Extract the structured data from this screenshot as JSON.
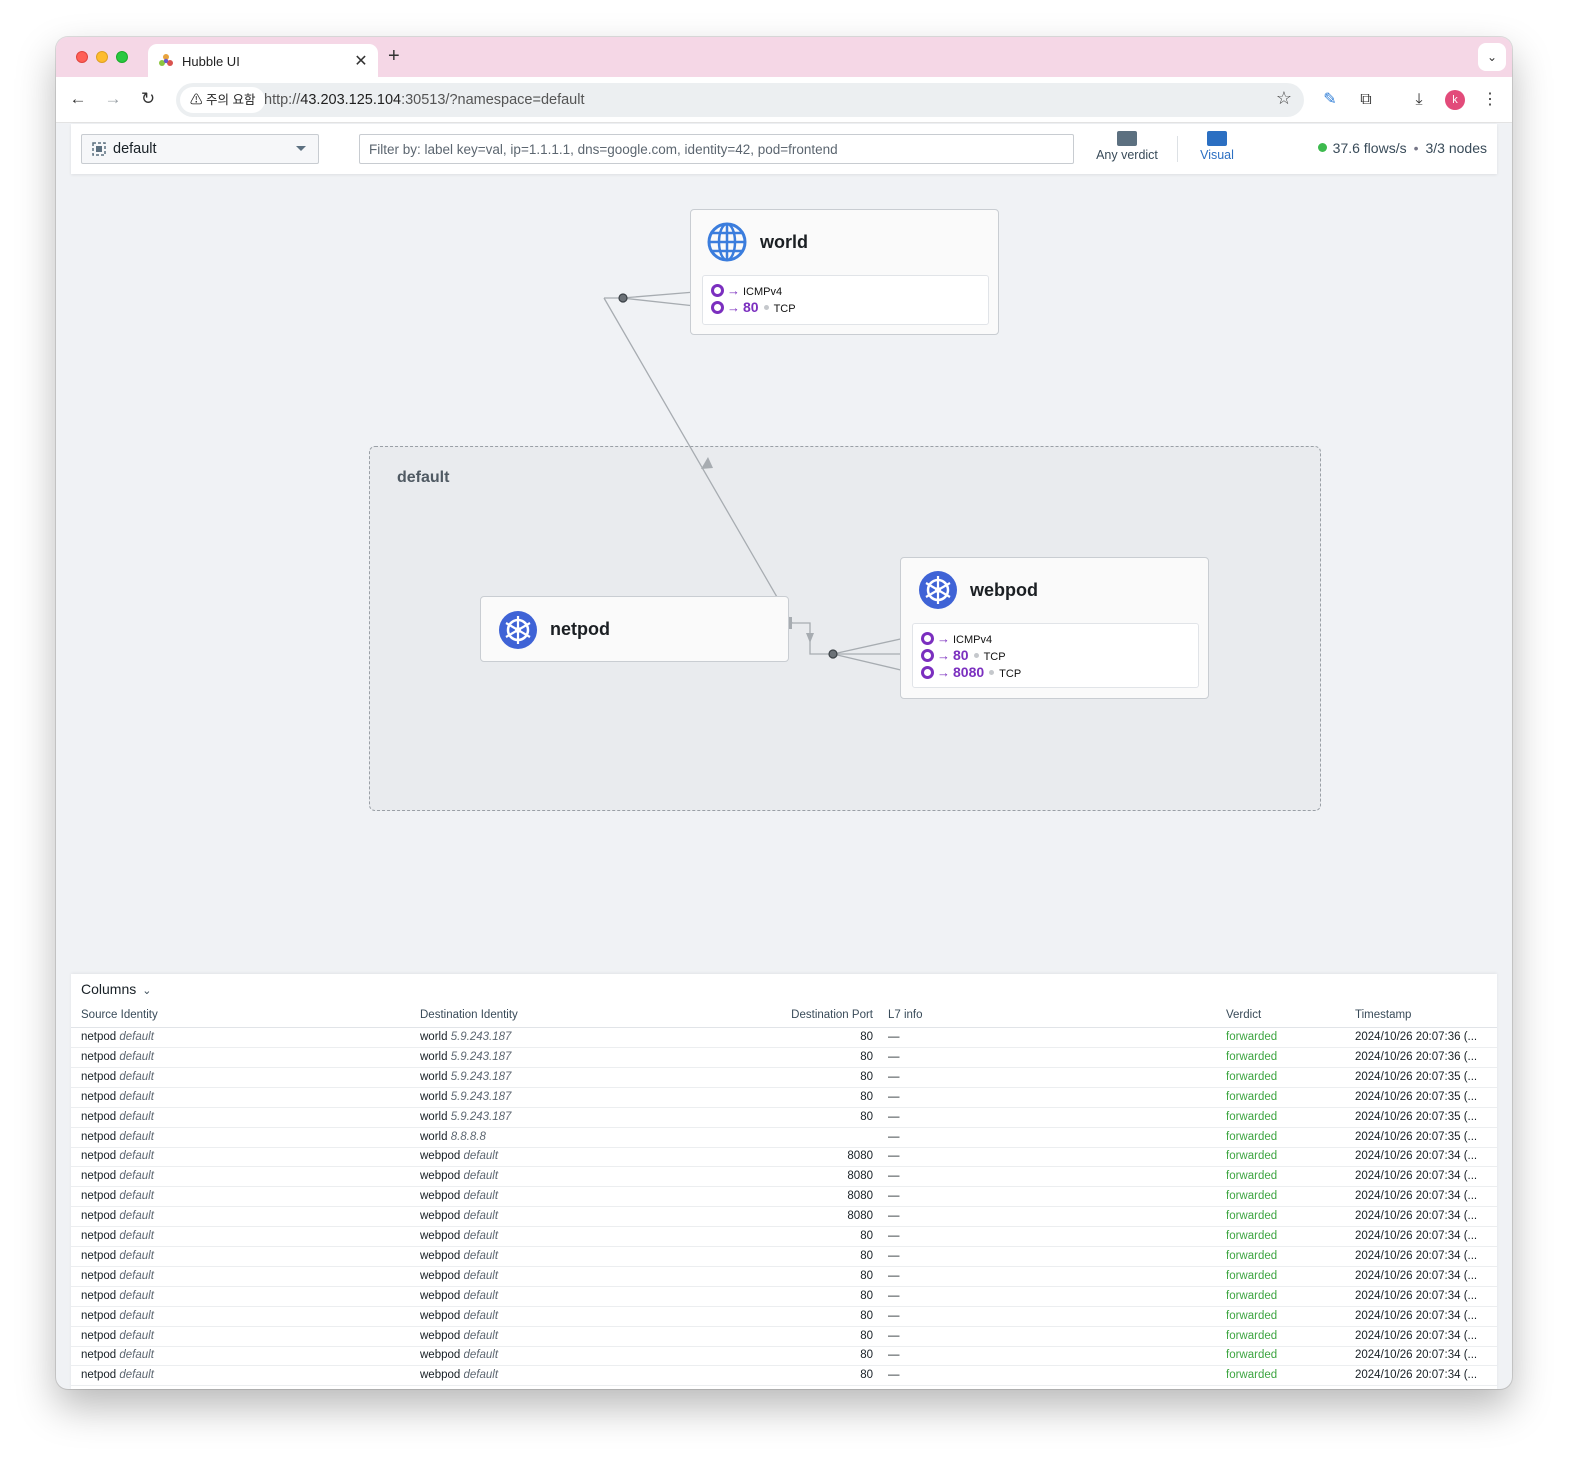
{
  "browser": {
    "tab_title": "Hubble UI",
    "new_tab_label": "+",
    "security_label": "⚠ 주의 요함",
    "url_scheme": "http://",
    "url_host": "43.203.125.104",
    "url_rest": ":30513/?namespace=default",
    "avatar_letter": "k"
  },
  "header": {
    "namespace": "default",
    "filter_placeholder": "Filter by: label key=val, ip=1.1.1.1, dns=google.com, identity=42, pod=frontend",
    "verdict_label": "Any verdict",
    "visual_label": "Visual",
    "flows_rate": "37.6 flows/s",
    "nodes": "3/3 nodes",
    "status_color": "#3dba4e"
  },
  "map": {
    "namespace_label": "default",
    "world": {
      "title": "world",
      "icon": "globe-icon",
      "ports": [
        {
          "port": "",
          "protocol": "ICMPv4"
        },
        {
          "port": "80",
          "protocol": "TCP"
        }
      ]
    },
    "netpod": {
      "title": "netpod",
      "icon": "kubernetes-icon"
    },
    "webpod": {
      "title": "webpod",
      "icon": "kubernetes-icon",
      "ports": [
        {
          "port": "",
          "protocol": "ICMPv4"
        },
        {
          "port": "80",
          "protocol": "TCP"
        },
        {
          "port": "8080",
          "protocol": "TCP"
        }
      ]
    }
  },
  "flows": {
    "columns_label": "Columns",
    "headers": [
      "Source Identity",
      "Destination Identity",
      "Destination Port",
      "L7 info",
      "Verdict",
      "Timestamp"
    ],
    "rows": [
      {
        "src": "netpod",
        "src_ns": "default",
        "dst": "world",
        "dst_detail": "5.9.243.187",
        "port": "80",
        "l7": "—",
        "verdict": "forwarded",
        "ts": "2024/10/26 20:07:36 (..."
      },
      {
        "src": "netpod",
        "src_ns": "default",
        "dst": "world",
        "dst_detail": "5.9.243.187",
        "port": "80",
        "l7": "—",
        "verdict": "forwarded",
        "ts": "2024/10/26 20:07:36 (..."
      },
      {
        "src": "netpod",
        "src_ns": "default",
        "dst": "world",
        "dst_detail": "5.9.243.187",
        "port": "80",
        "l7": "—",
        "verdict": "forwarded",
        "ts": "2024/10/26 20:07:35 (..."
      },
      {
        "src": "netpod",
        "src_ns": "default",
        "dst": "world",
        "dst_detail": "5.9.243.187",
        "port": "80",
        "l7": "—",
        "verdict": "forwarded",
        "ts": "2024/10/26 20:07:35 (..."
      },
      {
        "src": "netpod",
        "src_ns": "default",
        "dst": "world",
        "dst_detail": "5.9.243.187",
        "port": "80",
        "l7": "—",
        "verdict": "forwarded",
        "ts": "2024/10/26 20:07:35 (..."
      },
      {
        "src": "netpod",
        "src_ns": "default",
        "dst": "world",
        "dst_detail": "8.8.8.8",
        "port": "",
        "l7": "—",
        "verdict": "forwarded",
        "ts": "2024/10/26 20:07:35 (..."
      },
      {
        "src": "netpod",
        "src_ns": "default",
        "dst": "webpod",
        "dst_detail": "default",
        "port": "8080",
        "l7": "—",
        "verdict": "forwarded",
        "ts": "2024/10/26 20:07:34 (..."
      },
      {
        "src": "netpod",
        "src_ns": "default",
        "dst": "webpod",
        "dst_detail": "default",
        "port": "8080",
        "l7": "—",
        "verdict": "forwarded",
        "ts": "2024/10/26 20:07:34 (..."
      },
      {
        "src": "netpod",
        "src_ns": "default",
        "dst": "webpod",
        "dst_detail": "default",
        "port": "8080",
        "l7": "—",
        "verdict": "forwarded",
        "ts": "2024/10/26 20:07:34 (..."
      },
      {
        "src": "netpod",
        "src_ns": "default",
        "dst": "webpod",
        "dst_detail": "default",
        "port": "8080",
        "l7": "—",
        "verdict": "forwarded",
        "ts": "2024/10/26 20:07:34 (..."
      },
      {
        "src": "netpod",
        "src_ns": "default",
        "dst": "webpod",
        "dst_detail": "default",
        "port": "80",
        "l7": "—",
        "verdict": "forwarded",
        "ts": "2024/10/26 20:07:34 (..."
      },
      {
        "src": "netpod",
        "src_ns": "default",
        "dst": "webpod",
        "dst_detail": "default",
        "port": "80",
        "l7": "—",
        "verdict": "forwarded",
        "ts": "2024/10/26 20:07:34 (..."
      },
      {
        "src": "netpod",
        "src_ns": "default",
        "dst": "webpod",
        "dst_detail": "default",
        "port": "80",
        "l7": "—",
        "verdict": "forwarded",
        "ts": "2024/10/26 20:07:34 (..."
      },
      {
        "src": "netpod",
        "src_ns": "default",
        "dst": "webpod",
        "dst_detail": "default",
        "port": "80",
        "l7": "—",
        "verdict": "forwarded",
        "ts": "2024/10/26 20:07:34 (..."
      },
      {
        "src": "netpod",
        "src_ns": "default",
        "dst": "webpod",
        "dst_detail": "default",
        "port": "80",
        "l7": "—",
        "verdict": "forwarded",
        "ts": "2024/10/26 20:07:34 (..."
      },
      {
        "src": "netpod",
        "src_ns": "default",
        "dst": "webpod",
        "dst_detail": "default",
        "port": "80",
        "l7": "—",
        "verdict": "forwarded",
        "ts": "2024/10/26 20:07:34 (..."
      },
      {
        "src": "netpod",
        "src_ns": "default",
        "dst": "webpod",
        "dst_detail": "default",
        "port": "80",
        "l7": "—",
        "verdict": "forwarded",
        "ts": "2024/10/26 20:07:34 (..."
      },
      {
        "src": "netpod",
        "src_ns": "default",
        "dst": "webpod",
        "dst_detail": "default",
        "port": "80",
        "l7": "—",
        "verdict": "forwarded",
        "ts": "2024/10/26 20:07:34 (..."
      }
    ]
  }
}
